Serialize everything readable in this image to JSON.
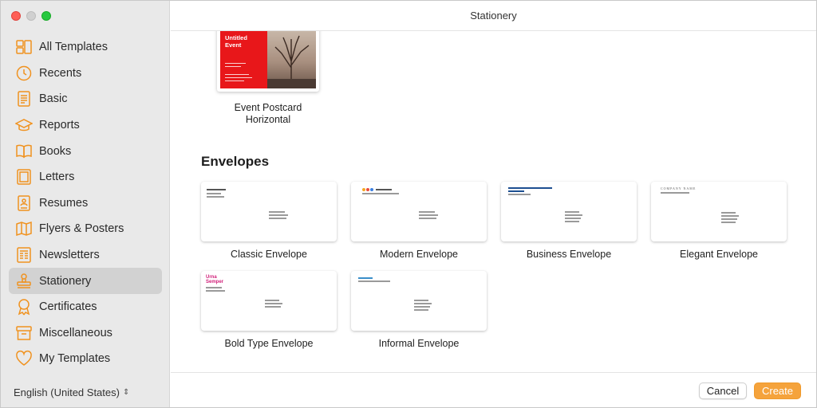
{
  "window": {
    "title": "Stationery"
  },
  "colors": {
    "accent": "#f0921f",
    "create_button": "#f5a33c",
    "postcard_red": "#e8171a"
  },
  "sidebar": {
    "items": [
      {
        "label": "All Templates",
        "icon": "all-templates-icon",
        "selected": false
      },
      {
        "label": "Recents",
        "icon": "clock-icon",
        "selected": false
      },
      {
        "label": "Basic",
        "icon": "document-icon",
        "selected": false
      },
      {
        "label": "Reports",
        "icon": "graduation-cap-icon",
        "selected": false
      },
      {
        "label": "Books",
        "icon": "book-icon",
        "selected": false
      },
      {
        "label": "Letters",
        "icon": "letter-icon",
        "selected": false
      },
      {
        "label": "Resumes",
        "icon": "resume-icon",
        "selected": false
      },
      {
        "label": "Flyers & Posters",
        "icon": "map-icon",
        "selected": false
      },
      {
        "label": "Newsletters",
        "icon": "newsletter-icon",
        "selected": false
      },
      {
        "label": "Stationery",
        "icon": "stamp-icon",
        "selected": true
      },
      {
        "label": "Certificates",
        "icon": "ribbon-icon",
        "selected": false
      },
      {
        "label": "Miscellaneous",
        "icon": "box-icon",
        "selected": false
      },
      {
        "label": "My Templates",
        "icon": "heart-icon",
        "selected": false
      }
    ],
    "language": "English (United States)"
  },
  "main": {
    "postcard": {
      "label_line1": "Event Postcard",
      "label_line2": "Horizontal",
      "card_title_line1": "Untitled",
      "card_title_line2": "Event"
    },
    "section_title": "Envelopes",
    "envelopes": [
      {
        "label": "Classic Envelope",
        "sender": "T. Ima Designer"
      },
      {
        "label": "Modern Envelope",
        "sender": "Urna Semper"
      },
      {
        "label": "Business Envelope",
        "sender": ""
      },
      {
        "label": "Elegant Envelope",
        "sender": "COMPANY NAME"
      },
      {
        "label": "Bold Type Envelope",
        "sender_line1": "Urna",
        "sender_line2": "Semper"
      },
      {
        "label": "Informal Envelope",
        "sender": ""
      }
    ]
  },
  "footer": {
    "cancel_label": "Cancel",
    "create_label": "Create"
  }
}
